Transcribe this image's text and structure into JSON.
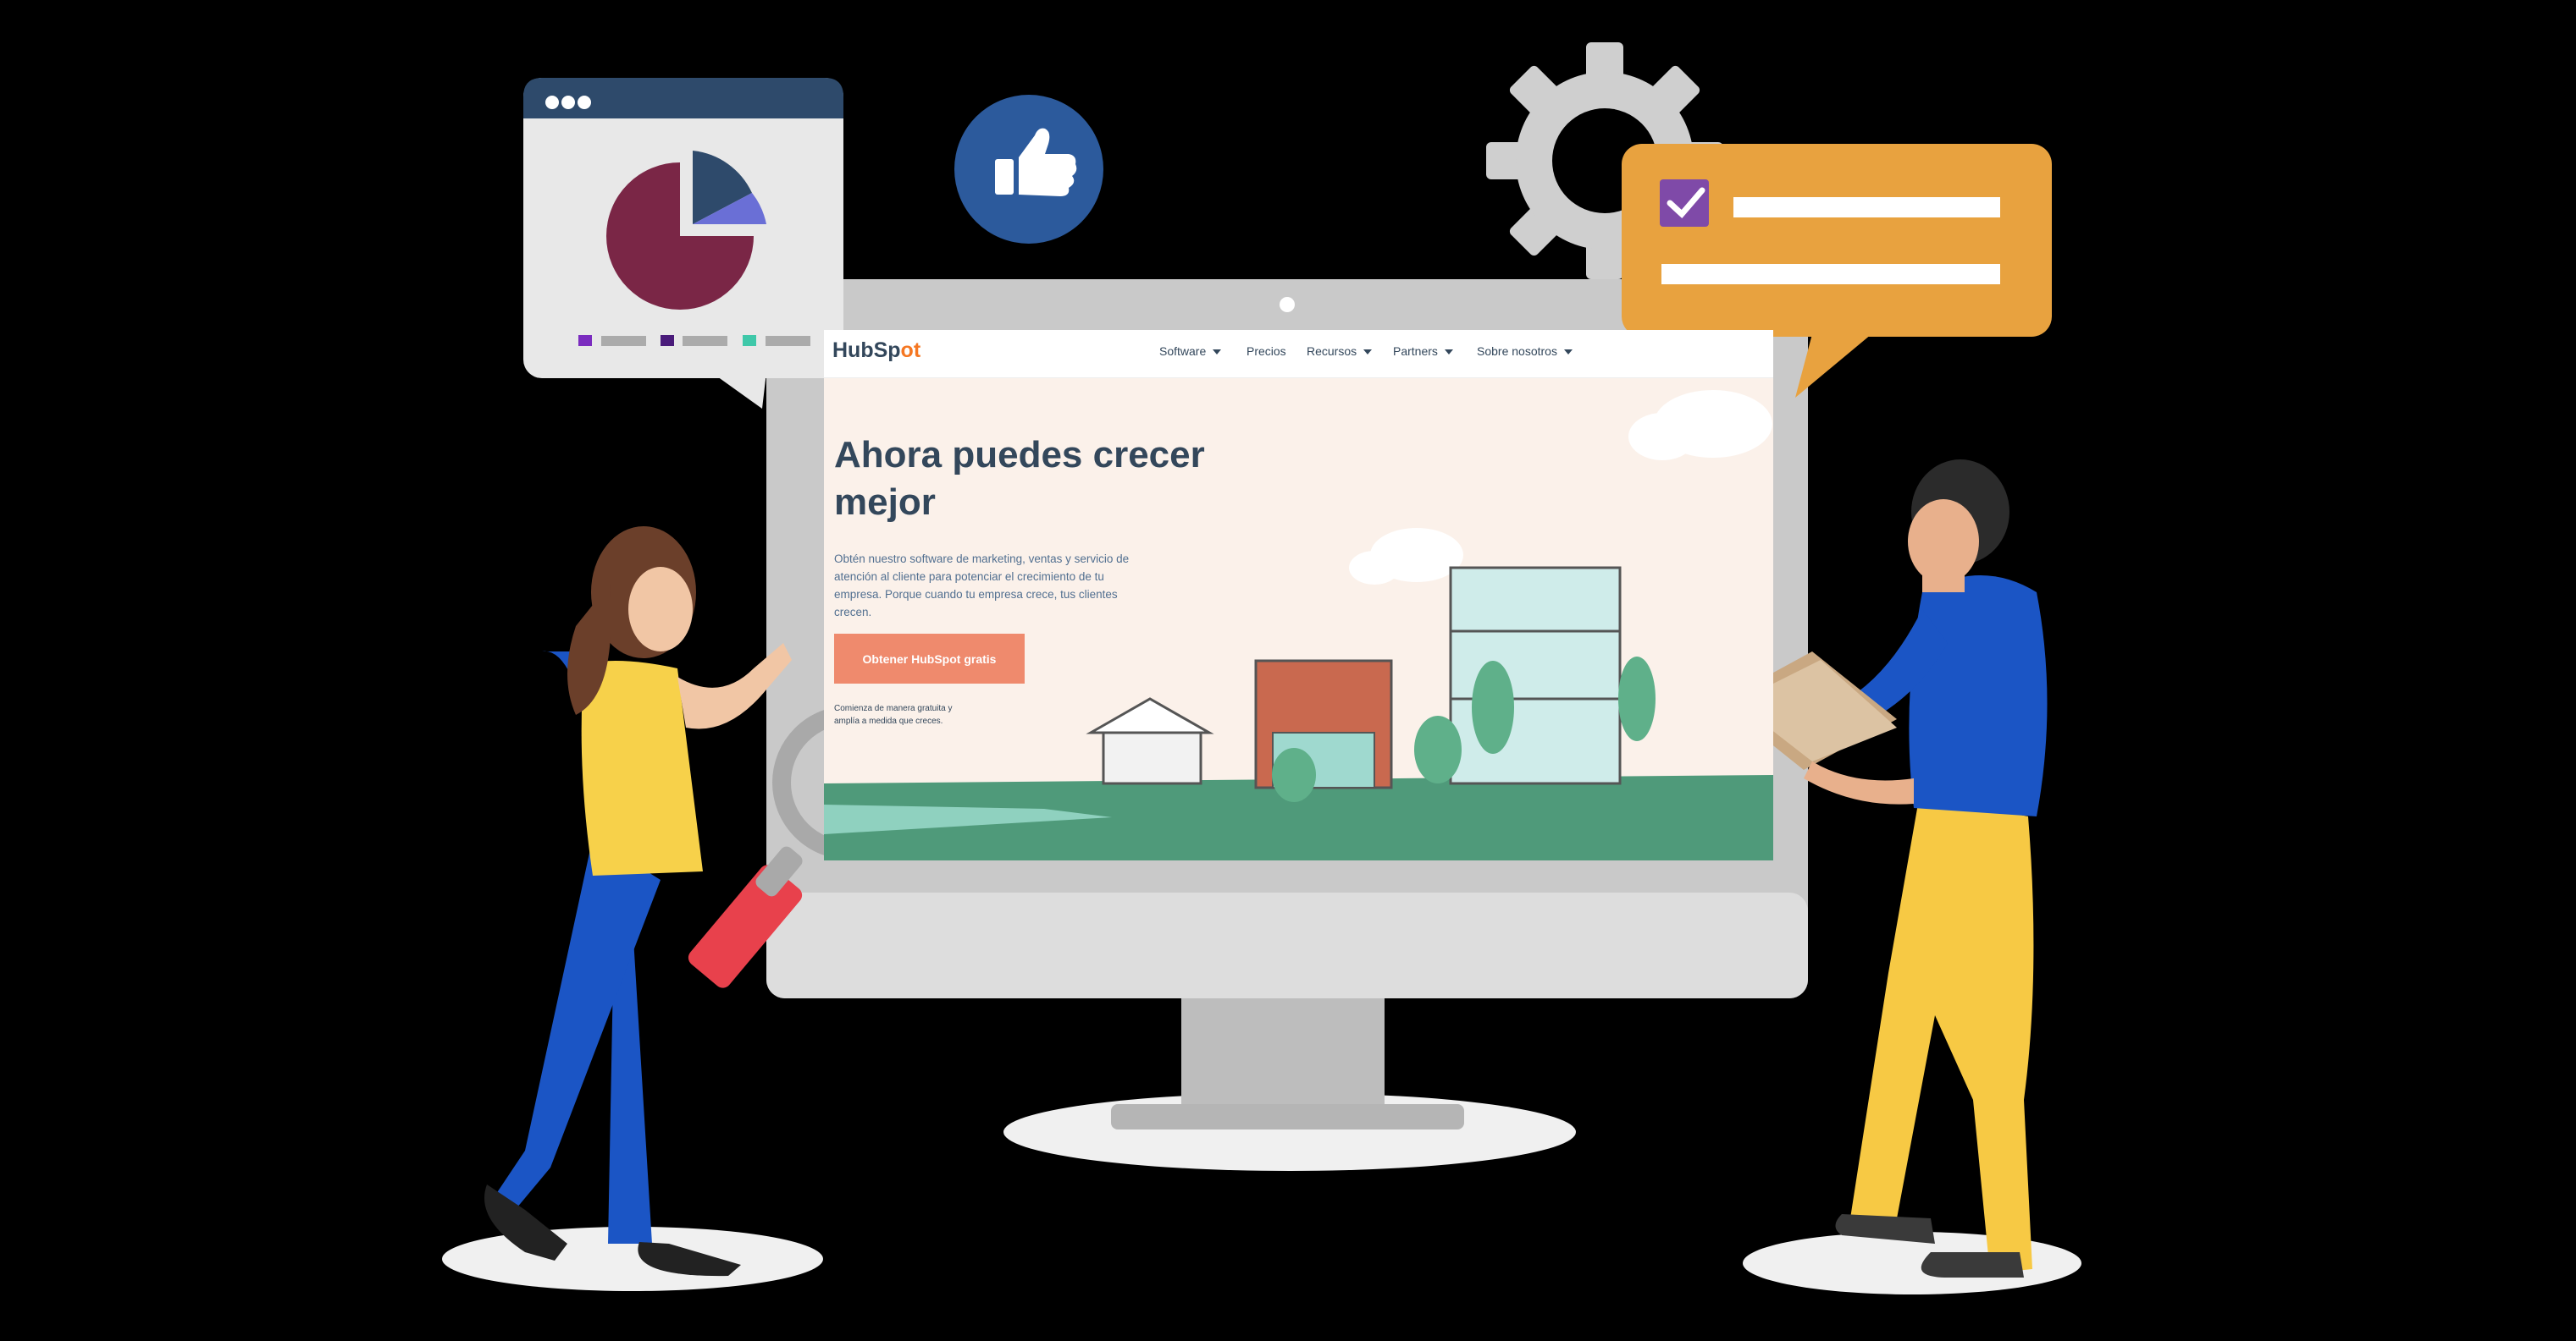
{
  "site": {
    "logo": {
      "text_a": "HubSp",
      "text_b": "ot"
    },
    "nav": [
      {
        "label": "Software",
        "has_menu": true
      },
      {
        "label": "Precios",
        "has_menu": false
      },
      {
        "label": "Recursos",
        "has_menu": true
      },
      {
        "label": "Partners",
        "has_menu": true
      },
      {
        "label": "Sobre nosotros",
        "has_menu": true
      }
    ],
    "hero": {
      "title": "Ahora puedes crecer mejor",
      "body": "Obtén nuestro software de marketing, ventas y servicio de atención al cliente para potenciar el crecimiento de tu empresa. Porque cuando tu empresa crece, tus clientes crecen.",
      "cta": "Obtener HubSpot gratis",
      "fine_print": "Comienza de manera gratuita y amplía a medida que creces."
    }
  },
  "colors": {
    "background": "#000000",
    "monitor": "#c9c9c9",
    "site_bg": "#fbf1ea",
    "brand_text": "#33475b",
    "logo_accent": "#f57722",
    "cta": "#ef8a6d",
    "ground": "#4f9a7a",
    "orange_card": "#e8a23f",
    "pie_main": "#7a2646",
    "pie_dark": "#2e4a6b",
    "pie_light": "#6a6fd6",
    "like_circle": "#2c5a9c",
    "woman_top": "#f7d14a",
    "pants_blue": "#1b55c5",
    "man_pants": "#f7c944"
  },
  "icons": [
    "pie-chart-icon",
    "thumbs-up-icon",
    "gear-icon",
    "checkbox-icon",
    "magnifier-icon",
    "folder-icon"
  ]
}
